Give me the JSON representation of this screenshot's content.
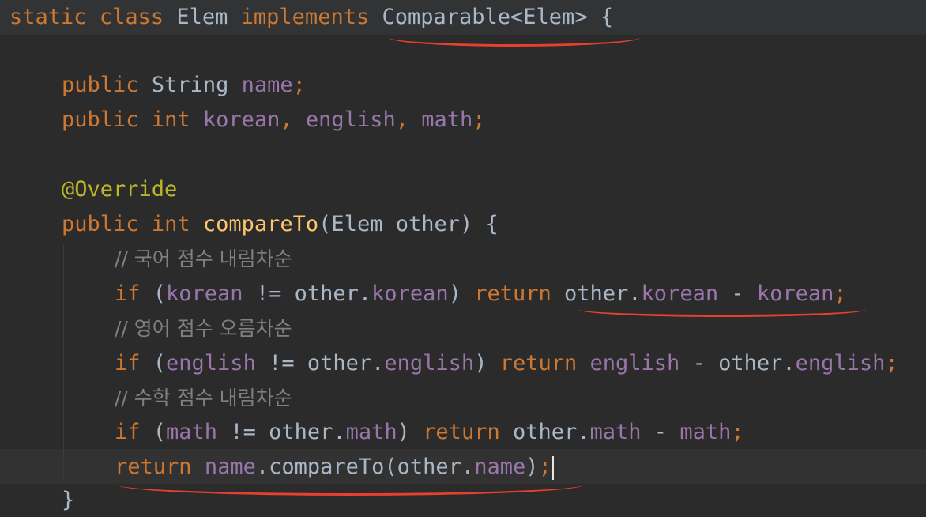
{
  "code": {
    "line1": {
      "static": "static",
      "class": "class",
      "classname": "Elem",
      "implements": "implements",
      "iface": "Comparable<Elem>",
      "brace": "{"
    },
    "line2": {
      "public": "public",
      "type": "String",
      "name": "name",
      "semi": ";"
    },
    "line3": {
      "public": "public",
      "type": "int",
      "f1": "korean",
      "c1": ", ",
      "f2": "english",
      "c2": ", ",
      "f3": "math",
      "semi": ";"
    },
    "line4": {
      "annotation": "@Override"
    },
    "line5": {
      "public": "public",
      "type": "int",
      "method": "compareTo",
      "params": "(Elem other) {"
    },
    "comment1": "// 국어 점수 내림차순",
    "line6": {
      "if": "if",
      "open": " (",
      "f1": "korean",
      "op": " != other.",
      "f2": "korean",
      "close": ") ",
      "return": "return",
      "other": " other.",
      "f3": "korean",
      "minus": " - ",
      "f4": "korean",
      "semi": ";"
    },
    "comment2": "// 영어 점수 오름차순",
    "line7": {
      "if": "if",
      "open": " (",
      "f1": "english",
      "op": " != other.",
      "f2": "english",
      "close": ") ",
      "return": "return",
      "sp": " ",
      "f3": "english",
      "minus": " - other.",
      "f4": "english",
      "semi": ";"
    },
    "comment3": "// 수학 점수 내림차순",
    "line8": {
      "if": "if",
      "open": " (",
      "f1": "math",
      "op": " != other.",
      "f2": "math",
      "close": ") ",
      "return": "return",
      "other": " other.",
      "f3": "math",
      "minus": " - ",
      "f4": "math",
      "semi": ";"
    },
    "line9": {
      "return": "return",
      "sp": " ",
      "f1": "name",
      "call": ".compareTo(other.",
      "f2": "name",
      "close": ")",
      "semi": ";"
    },
    "line10": {
      "brace": "}"
    }
  },
  "colors": {
    "background": "#2b2b2b",
    "keyword": "#cc7832",
    "field": "#9876aa",
    "method": "#ffc66d",
    "annotation": "#bbb529",
    "comment": "#808080",
    "underline": "#e8402e"
  }
}
